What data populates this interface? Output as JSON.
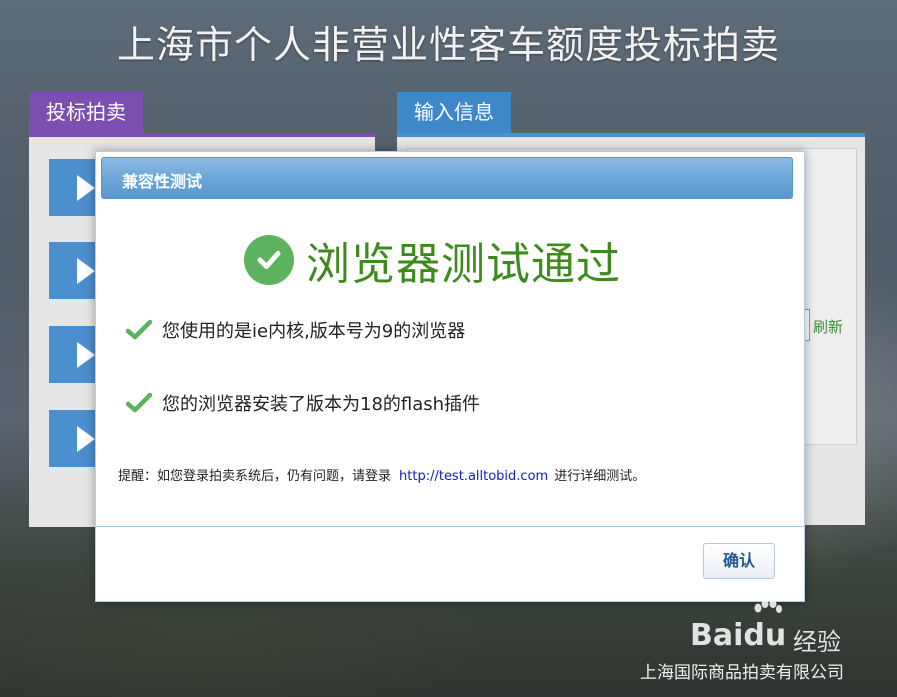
{
  "page": {
    "title": "上海市个人非营业性客车额度投标拍卖"
  },
  "left_panel": {
    "tab_label": "投标拍卖",
    "accent_color": "#7a4fb0",
    "buttons": [
      {
        "icon": "play-icon"
      },
      {
        "icon": "play-icon"
      },
      {
        "icon": "play-icon"
      },
      {
        "icon": "play-icon"
      }
    ]
  },
  "right_panel": {
    "tab_label": "输入信息",
    "accent_color": "#3e87c9",
    "refresh_label": "刷新"
  },
  "dialog": {
    "title": "兼容性测试",
    "result_text": "浏览器测试通过",
    "result_icon": "check-circle-icon",
    "lines": [
      {
        "icon": "check-icon",
        "text": "您使用的是ie内核,版本号为9的浏览器"
      },
      {
        "icon": "check-icon",
        "text": "您的浏览器安装了版本为18的flash插件"
      }
    ],
    "reminder_prefix": "提醒：如您登录拍卖系统后，仍有问题，请登录",
    "reminder_url": "http://test.alltobid.com",
    "reminder_suffix": "进行详细测试。",
    "ok_label": "确认",
    "result_color": "#3f8a1c"
  },
  "watermark": {
    "brand_bai": "Bai",
    "brand_du": "du",
    "brand_jingyan": "经验"
  },
  "footer": {
    "company": "上海国际商品拍卖有限公司"
  }
}
